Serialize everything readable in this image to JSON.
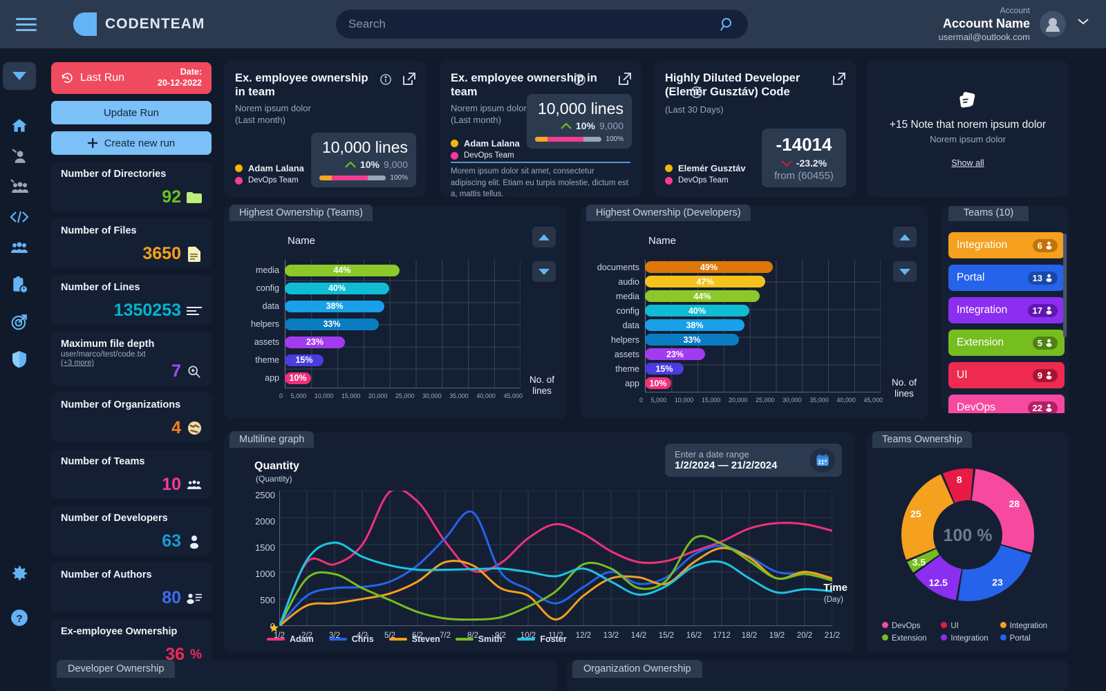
{
  "header": {
    "brand": "CODENTEAM",
    "search_placeholder": "Search",
    "search_value": "",
    "account_label": "Account",
    "account_name": "Account Name",
    "account_email": "usermail@outlook.com"
  },
  "rail": {
    "items": [
      {
        "name": "collapse-toggle",
        "icon": "chevron-down-icon"
      },
      {
        "name": "home",
        "icon": "home-icon"
      },
      {
        "name": "developer",
        "icon": "person-add-icon"
      },
      {
        "name": "teams-add",
        "icon": "people-add-icon"
      },
      {
        "name": "code",
        "icon": "code-icon"
      },
      {
        "name": "groups",
        "icon": "people-icon"
      },
      {
        "name": "reports",
        "icon": "clipboard-clock-icon"
      },
      {
        "name": "targets",
        "icon": "target-icon"
      },
      {
        "name": "security",
        "icon": "shield-icon"
      },
      {
        "name": "settings",
        "icon": "gear-icon"
      },
      {
        "name": "help",
        "icon": "question-icon"
      }
    ]
  },
  "stats": {
    "last_run_label": "Last Run",
    "last_run_date_label": "Date:",
    "last_run_date": "20-12-2022",
    "update_run": "Update Run",
    "create_new_run": "Create new run",
    "cards": [
      {
        "title": "Number of Directories",
        "value": "92",
        "color": "#6cc024",
        "icon": "folder-icon"
      },
      {
        "title": "Number of Files",
        "value": "3650",
        "color": "#f5a01e",
        "icon": "file-icon"
      },
      {
        "title": "Number of Lines",
        "value": "1350253",
        "color": "#00b6cc",
        "icon": "lines-icon"
      },
      {
        "title": "Maximum file depth",
        "subtitle": "user/marco/test/code.txt",
        "more": "(+3 more)",
        "value": "7",
        "color": "#9b4dff",
        "icon": "zoom-in-icon"
      },
      {
        "title": "Number of Organizations",
        "value": "4",
        "color": "#f5821f",
        "icon": "globe-icon"
      },
      {
        "title": "Number of Teams",
        "value": "10",
        "color": "#f6399a",
        "icon": "people-icon"
      },
      {
        "title": "Number of Developers",
        "value": "63",
        "color": "#1b9ad6",
        "icon": "person-icon"
      },
      {
        "title": "Number of Authors",
        "value": "80",
        "color": "#3d6cf0",
        "icon": "person-list-icon"
      },
      {
        "title": "Ex-employee Ownership",
        "value": "36",
        "unit": "%",
        "color": "#ef2a5a",
        "icon": "percent-icon"
      }
    ]
  },
  "kpis": [
    {
      "title": "Ex. employee ownership in team",
      "has_info": true,
      "sub1": "Norem ipsum dolor",
      "sub2": "(Last month)",
      "value": "10,000",
      "unit": "lines",
      "delta": "10%",
      "delta_dir": "up",
      "prev": "9,000",
      "bar_pct": "100%",
      "legend": [
        {
          "label": "Adam Lalana",
          "color": "#f5b50a"
        },
        {
          "label": "DevOps Team",
          "color": "#f6399a"
        }
      ]
    },
    {
      "title": "Ex. employee ownership in team",
      "has_info": true,
      "sub1": "Norem ipsum dolor",
      "sub2": "(Last month)",
      "value": "10,000",
      "unit": "lines",
      "delta": "10%",
      "delta_dir": "up",
      "prev": "9,000",
      "bar_pct": "100%",
      "legend": [
        {
          "label": "Adam Lalana",
          "color": "#f5b50a"
        },
        {
          "label": "DevOps Team",
          "color": "#f6399a"
        }
      ],
      "footnote": "Morem ipsum dolor sit amet, consectetur adipiscing elit. Etiam eu turpis molestie, dictum est a, mattis tellus."
    },
    {
      "title": "Highly Diluted Developer (Elemér Gusztáv) Code",
      "has_info": true,
      "sub1": "",
      "sub2": "(Last 30 Days)",
      "value": "-14014",
      "unit": "",
      "delta": "-23.2%",
      "delta_dir": "down",
      "prev": "from (60455)",
      "legend": [
        {
          "label": "Elemér Gusztáv",
          "color": "#f5b50a"
        },
        {
          "label": "DevOps Team",
          "color": "#f6399a"
        }
      ]
    }
  ],
  "notes": {
    "icon": "notes-icon",
    "title": "+15 Note that norem ipsum dolor",
    "subtitle": "Norem ipsum dolor",
    "link": "Show all"
  },
  "chart_data": [
    {
      "type": "bar",
      "title": "Highest Ownership (Teams)",
      "orientation": "horizontal",
      "ylabel": "Name",
      "xlabel": "No. of lines",
      "xlim": [
        0,
        45000
      ],
      "xticks": [
        "0",
        "5,000",
        "10,000",
        "15,000",
        "20,000",
        "25,000",
        "30,000",
        "35,000",
        "40,000",
        "45,000"
      ],
      "grid": true,
      "categories": [
        "media",
        "config",
        "data",
        "helpers",
        "assets",
        "theme",
        "app"
      ],
      "labels": [
        "44%",
        "40%",
        "38%",
        "33%",
        "23%",
        "15%",
        "10%"
      ],
      "values": [
        22000,
        20000,
        19000,
        18000,
        11500,
        7500,
        5000
      ],
      "colors": [
        "#8cc82a",
        "#10bcd4",
        "#18a0e8",
        "#0a7cc2",
        "#a23bf0",
        "#4a3ce0",
        "#f0317a"
      ]
    },
    {
      "type": "bar",
      "title": "Highest Ownership (Developers)",
      "orientation": "horizontal",
      "ylabel": "Name",
      "xlabel": "No. of lines",
      "xlim": [
        0,
        45000
      ],
      "xticks": [
        "0",
        "5,000",
        "10,000",
        "15,000",
        "20,000",
        "25,000",
        "30,000",
        "35,000",
        "40,000",
        "45,000"
      ],
      "grid": true,
      "categories": [
        "documents",
        "audio",
        "media",
        "config",
        "data",
        "helpers",
        "assets",
        "theme",
        "app"
      ],
      "labels": [
        "49%",
        "47%",
        "44%",
        "40%",
        "38%",
        "33%",
        "23%",
        "15%",
        "10%"
      ],
      "values": [
        24500,
        23000,
        22000,
        20000,
        19000,
        18000,
        11500,
        7500,
        5000
      ],
      "colors": [
        "#e07707",
        "#f5c21a",
        "#8cc82a",
        "#10bcd4",
        "#18a0e8",
        "#0a7cc2",
        "#a23bf0",
        "#4a3ce0",
        "#f0317a"
      ]
    },
    {
      "type": "line",
      "title": "Multiline graph",
      "ylabel": "Quantity",
      "ylabel_sub": "(Quantity)",
      "xlabel": "Time",
      "xlabel_sub": "(Day)",
      "ylim": [
        0,
        2500
      ],
      "yticks": [
        "0",
        "500",
        "1000",
        "1500",
        "2000",
        "2500"
      ],
      "x": [
        "1/2",
        "2/2",
        "3/2",
        "4/2",
        "5/2",
        "6/2",
        "7/2",
        "8/2",
        "9/2",
        "10/2",
        "11/2",
        "12/2",
        "13/2",
        "14/2",
        "15/2",
        "16/2",
        "1712",
        "18/2",
        "19/2",
        "20/2",
        "21/2"
      ],
      "series": [
        {
          "name": "Adam",
          "color": "#f0317a",
          "values": [
            0,
            1180,
            1140,
            1500,
            2480,
            2300,
            1560,
            1020,
            1160,
            1620,
            1880,
            1700,
            1380,
            1180,
            1200,
            1380,
            1560,
            1800,
            1900,
            1880,
            1760
          ]
        },
        {
          "name": "Chris",
          "color": "#2563eb",
          "values": [
            0,
            560,
            700,
            720,
            820,
            1120,
            1620,
            2100,
            1000,
            680,
            420,
            720,
            1000,
            780,
            900,
            1320,
            1480,
            1280,
            1000,
            960,
            880
          ]
        },
        {
          "name": "Steven",
          "color": "#f5a01e",
          "values": [
            0,
            380,
            420,
            500,
            600,
            820,
            1180,
            1120,
            700,
            560,
            120,
            560,
            880,
            900,
            780,
            1180,
            1440,
            1260,
            880,
            1000,
            880
          ]
        },
        {
          "name": "Smith",
          "color": "#76bd20",
          "values": [
            0,
            880,
            960,
            700,
            480,
            260,
            140,
            120,
            160,
            360,
            640,
            1140,
            1060,
            700,
            840,
            1620,
            1520,
            1200,
            880,
            960,
            840
          ]
        },
        {
          "name": "Foster",
          "color": "#1ec4e0",
          "values": [
            0,
            1220,
            1540,
            1280,
            1120,
            1040,
            1040,
            1050,
            1060,
            1000,
            920,
            1060,
            820,
            580,
            740,
            1100,
            1180,
            880,
            620,
            680,
            640
          ]
        }
      ],
      "date_range_label": "Enter a date range",
      "date_range_from": "1/2/2024",
      "date_range_to": "21/2/2024",
      "date_range_sep": "—"
    },
    {
      "type": "pie",
      "title": "Teams Ownership",
      "center_label": "100 %",
      "labels": [
        "DevOps",
        "Portal",
        "Integration",
        "Extension",
        "Integration",
        "UI"
      ],
      "values": [
        28,
        23,
        12.5,
        3.5,
        25,
        8
      ],
      "colors": [
        "#f6499f",
        "#2563eb",
        "#8b2ef0",
        "#76bd20",
        "#f5a01e",
        "#e81b46"
      ],
      "legend": [
        {
          "label": "DevOps",
          "color": "#f6499f"
        },
        {
          "label": "UI",
          "color": "#e81b46"
        },
        {
          "label": "Integration",
          "color": "#f5a01e"
        },
        {
          "label": "Extension",
          "color": "#76bd20"
        },
        {
          "label": "Integration",
          "color": "#8b2ef0"
        },
        {
          "label": "Portal",
          "color": "#2563eb"
        }
      ]
    }
  ],
  "teams_panel": {
    "title": "Teams (10)",
    "rows": [
      {
        "label": "Integration",
        "count": "6",
        "bg": "#f5a01e",
        "badge": "#c27208"
      },
      {
        "label": "Portal",
        "count": "13",
        "bg": "#2563eb",
        "badge": "#1a47a8"
      },
      {
        "label": "Integration",
        "count": "17",
        "bg": "#8b2ef0",
        "badge": "#5f17b0"
      },
      {
        "label": "Extension",
        "count": "5",
        "bg": "#76bd20",
        "badge": "#4f8213"
      },
      {
        "label": "UI",
        "count": "9",
        "bg": "#ef2a50",
        "badge": "#a81330"
      },
      {
        "label": "DevOps",
        "count": "22",
        "bg": "#f6499f",
        "badge": "#b51f68"
      }
    ]
  },
  "bottom_tabs": [
    {
      "label": "Developer Ownership"
    },
    {
      "label": "Organization Ownership"
    }
  ]
}
